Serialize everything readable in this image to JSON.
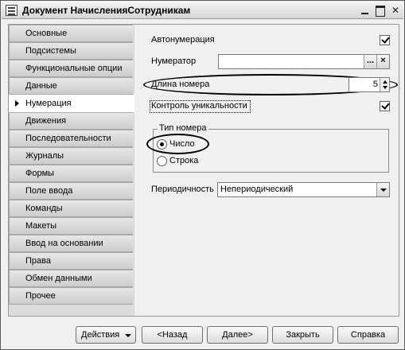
{
  "window": {
    "title": "Документ НачисленияСотрудникам",
    "app_icon": "form-icon",
    "controls": [
      "minimize-icon",
      "maximize-icon",
      "close-icon"
    ]
  },
  "sidebar": {
    "items": [
      {
        "label": "Основные",
        "active": false
      },
      {
        "label": "Подсистемы",
        "active": false
      },
      {
        "label": "Функциональные опции",
        "active": false
      },
      {
        "label": "Данные",
        "active": false
      },
      {
        "label": "Нумерация",
        "active": true
      },
      {
        "label": "Движения",
        "active": false
      },
      {
        "label": "Последовательности",
        "active": false
      },
      {
        "label": "Журналы",
        "active": false
      },
      {
        "label": "Формы",
        "active": false
      },
      {
        "label": "Поле ввода",
        "active": false
      },
      {
        "label": "Команды",
        "active": false
      },
      {
        "label": "Макеты",
        "active": false
      },
      {
        "label": "Ввод на основании",
        "active": false
      },
      {
        "label": "Права",
        "active": false
      },
      {
        "label": "Обмен данными",
        "active": false
      },
      {
        "label": "Прочее",
        "active": false
      }
    ]
  },
  "form": {
    "autonumbering_label": "Автонумерация",
    "autonumbering_checked": true,
    "numerator_label": "Нумератор",
    "numerator_value": "",
    "numerator_select_button": "...",
    "numerator_clear_button": "×",
    "number_length_label": "Длина номера",
    "number_length_value": "5",
    "uniqueness_label": "Контроль уникальности",
    "uniqueness_checked": true,
    "number_type_group_label": "Тип номера",
    "number_type_options": [
      {
        "label": "Число",
        "selected": true
      },
      {
        "label": "Строка",
        "selected": false
      }
    ],
    "periodicity_label": "Периодичность",
    "periodicity_value": "Непериодический"
  },
  "buttons": {
    "actions": "Действия",
    "back": "<Назад",
    "next": "Далее>",
    "close": "Закрыть",
    "help": "Справка"
  },
  "colors": {
    "window_bg": "#f0f0f0",
    "active_tab_bg": "#ffffff",
    "highlight_oval": "#000000"
  }
}
